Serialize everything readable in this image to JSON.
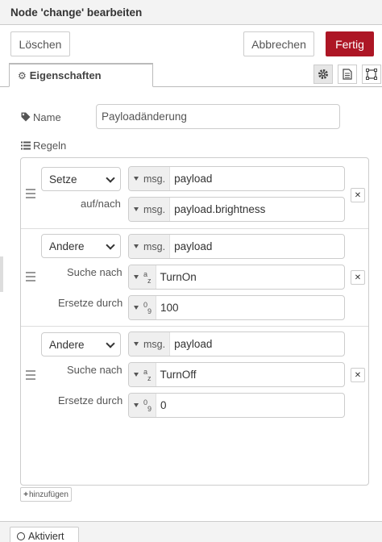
{
  "header": {
    "title": "Node 'change' bearbeiten"
  },
  "toolbar": {
    "delete_label": "Löschen",
    "cancel_label": "Abbrechen",
    "done_label": "Fertig"
  },
  "tabs": {
    "properties_label": "Eigenschaften",
    "icons": [
      "gear-icon",
      "description-icon",
      "appearance-icon"
    ]
  },
  "form": {
    "name_label": "Name",
    "name_value": "Payloadänderung",
    "rules_label": "Regeln"
  },
  "rules": [
    {
      "action": "Setze",
      "target": {
        "type": "msg.",
        "value": "payload"
      },
      "to_label": "auf/nach",
      "to": {
        "type": "msg.",
        "value": "payload.brightness"
      }
    },
    {
      "action": "Andere",
      "target": {
        "type": "msg.",
        "value": "payload"
      },
      "search_label": "Suche nach",
      "search": {
        "type": "string",
        "value": "TurnOn"
      },
      "replace_label": "Ersetze durch",
      "replace": {
        "type": "number",
        "value": "100"
      }
    },
    {
      "action": "Andere",
      "target": {
        "type": "msg.",
        "value": "payload"
      },
      "search_label": "Suche nach",
      "search": {
        "type": "string",
        "value": "TurnOff"
      },
      "replace_label": "Ersetze durch",
      "replace": {
        "type": "number",
        "value": "0"
      }
    }
  ],
  "add_label": "hinzufügen",
  "footer": {
    "enabled_label": "Aktiviert"
  },
  "colors": {
    "primary": "#ad1625",
    "border": "#cccccc",
    "header_bg": "#f3f3f3"
  }
}
